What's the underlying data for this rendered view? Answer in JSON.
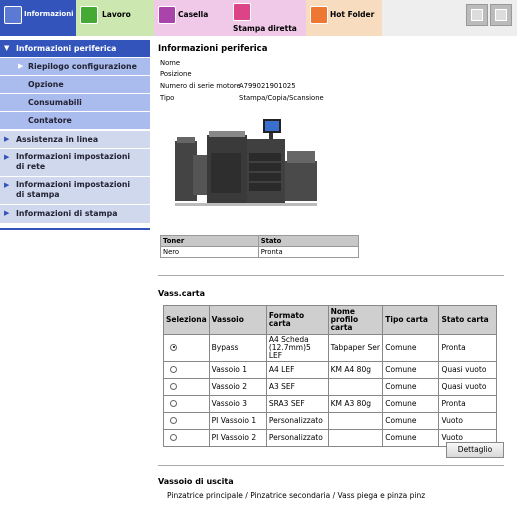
{
  "tabs": [
    {
      "label": "Informazioni"
    },
    {
      "label": "Lavoro"
    },
    {
      "label": "Casella"
    },
    {
      "label": "Stampa diretta"
    },
    {
      "label": "Hot Folder"
    }
  ],
  "sidebar": {
    "items": [
      {
        "label": "Informazioni periferica"
      },
      {
        "label": "Riepilogo configurazione"
      },
      {
        "label": "Opzione"
      },
      {
        "label": "Consumabili"
      },
      {
        "label": "Contatore"
      },
      {
        "label": "Assistenza in linea"
      },
      {
        "label": "Informazioni impostazioni di rete"
      },
      {
        "label": "Informazioni impostazioni di stampa"
      },
      {
        "label": "Informazioni di stampa"
      }
    ]
  },
  "device": {
    "title": "Informazioni periferica",
    "labels": [
      "Nome",
      "Posizione",
      "Numero di serie motore",
      "Tipo"
    ],
    "values": [
      "",
      "",
      "A799021901025",
      "Stampa/Copia/Scansione"
    ]
  },
  "toner": {
    "headers": [
      "Toner",
      "Stato"
    ],
    "rows": [
      [
        "Nero",
        "Pronta"
      ]
    ]
  },
  "trays": {
    "title": "Vass.carta",
    "headers": [
      "Seleziona",
      "Vassoio",
      "Formato carta",
      "Nome profilo carta",
      "Tipo carta",
      "Stato carta"
    ],
    "rows": [
      {
        "selected": true,
        "cells": [
          "Bypass",
          "A4 Scheda (12.7mm)5 LEF",
          "Tabpaper Ser",
          "Comune",
          "Pronta"
        ]
      },
      {
        "selected": false,
        "cells": [
          "Vassoio 1",
          "A4 LEF",
          "KM A4 80g",
          "Comune",
          "Quasi vuoto"
        ]
      },
      {
        "selected": false,
        "cells": [
          "Vassoio 2",
          "A3 SEF",
          "",
          "Comune",
          "Quasi vuoto"
        ]
      },
      {
        "selected": false,
        "cells": [
          "Vassoio 3",
          "SRA3 SEF",
          "KM A3 80g",
          "Comune",
          "Pronta"
        ]
      },
      {
        "selected": false,
        "cells": [
          "PI Vassoio 1",
          "Personalizzato",
          "",
          "Comune",
          "Vuoto"
        ]
      },
      {
        "selected": false,
        "cells": [
          "PI Vassoio 2",
          "Personalizzato",
          "",
          "Comune",
          "Vuoto"
        ]
      }
    ],
    "detail_button": "Dettaglio"
  },
  "output": {
    "title": "Vassoio di uscita",
    "value": "Pinzatrice principale / Pinzatrice secondaria / Vass piega e pinza pinz"
  }
}
